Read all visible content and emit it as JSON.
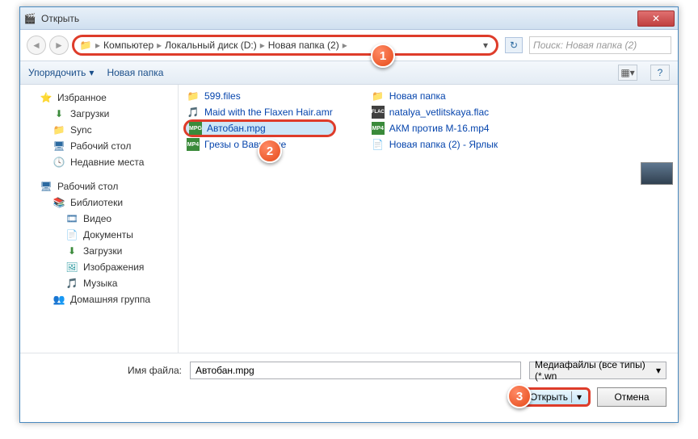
{
  "window": {
    "title": "Открыть"
  },
  "nav": {
    "crumbs": [
      "Компьютер",
      "Локальный диск (D:)",
      "Новая папка (2)"
    ],
    "search_placeholder": "Поиск: Новая папка (2)"
  },
  "toolbar": {
    "organize": "Упорядочить",
    "newfolder": "Новая папка"
  },
  "sidebar": {
    "favorites": "Избранное",
    "fav_items": [
      "Загрузки",
      "Sync",
      "Рабочий стол",
      "Недавние места"
    ],
    "desktop": "Рабочий стол",
    "libraries": "Библиотеки",
    "lib_items": [
      "Видео",
      "Документы",
      "Загрузки",
      "Изображения",
      "Музыка"
    ],
    "homegroup": "Домашняя группа"
  },
  "files": {
    "col1": [
      {
        "name": "599.files",
        "type": "folder"
      },
      {
        "name": "Maid with the Flaxen Hair.amr",
        "type": "amr"
      },
      {
        "name": "Автобан.mpg",
        "type": "mpg",
        "selected": true
      },
      {
        "name": "Грезы о Вавилоне",
        "type": "mp4"
      }
    ],
    "col2": [
      {
        "name": "Новая папка",
        "type": "folder"
      },
      {
        "name": "natalya_vetlitskaya.flac",
        "type": "flac"
      },
      {
        "name": "АКМ против М-16.mp4",
        "type": "mp4"
      },
      {
        "name": "Новая папка (2) - Ярлык",
        "type": "shortcut"
      }
    ]
  },
  "bottom": {
    "filename_label": "Имя файла:",
    "filename_value": "Автобан.mpg",
    "filter": "Медиафайлы (все типы) (*.wn",
    "open": "Открыть",
    "cancel": "Отмена"
  },
  "markers": [
    "1",
    "2",
    "3"
  ]
}
